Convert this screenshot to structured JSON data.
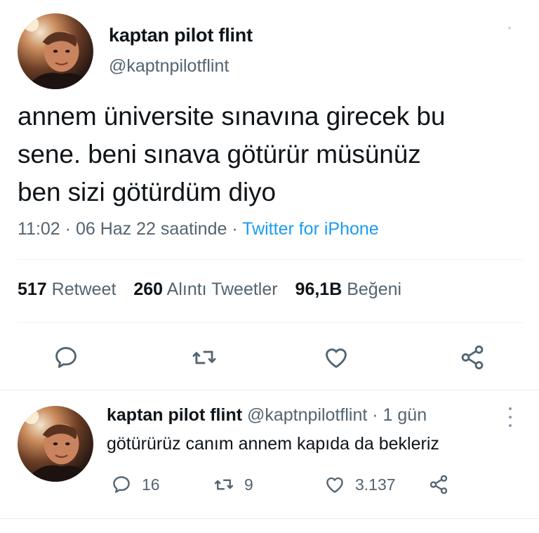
{
  "main_tweet": {
    "display_name": "kaptan pilot flint",
    "handle": "@kaptnpilotflint",
    "text_lines": [
      "annem üniversite sınavına girecek bu",
      "sene. beni sınava götürür müsünüz",
      "ben sizi götürdüm diyo"
    ],
    "time": "11:02",
    "date": "06 Haz 22 saatinde",
    "separator": "·",
    "source": "Twitter for iPhone",
    "stats": {
      "retweets_count": "517",
      "retweets_label": "Retweet",
      "quotes_count": "260",
      "quotes_label": "Alıntı Tweetler",
      "likes_count": "96,1B",
      "likes_label": "Beğeni"
    },
    "actions": {
      "reply_icon": "reply-icon",
      "retweet_icon": "retweet-icon",
      "like_icon": "heart-icon",
      "share_icon": "share-icon"
    }
  },
  "reply_tweet": {
    "display_name": "kaptan pilot flint",
    "handle": "@kaptnpilotflint",
    "separator": "·",
    "time_ago": "1 gün",
    "text": "götürürüz canım annem kapıda da bekleriz",
    "reply_count": "16",
    "retweet_count": "9",
    "like_count": "3.137"
  },
  "colors": {
    "text_primary": "#0f1419",
    "text_secondary": "#536471",
    "link": "#1d9bf0",
    "divider": "#eff3f4"
  }
}
